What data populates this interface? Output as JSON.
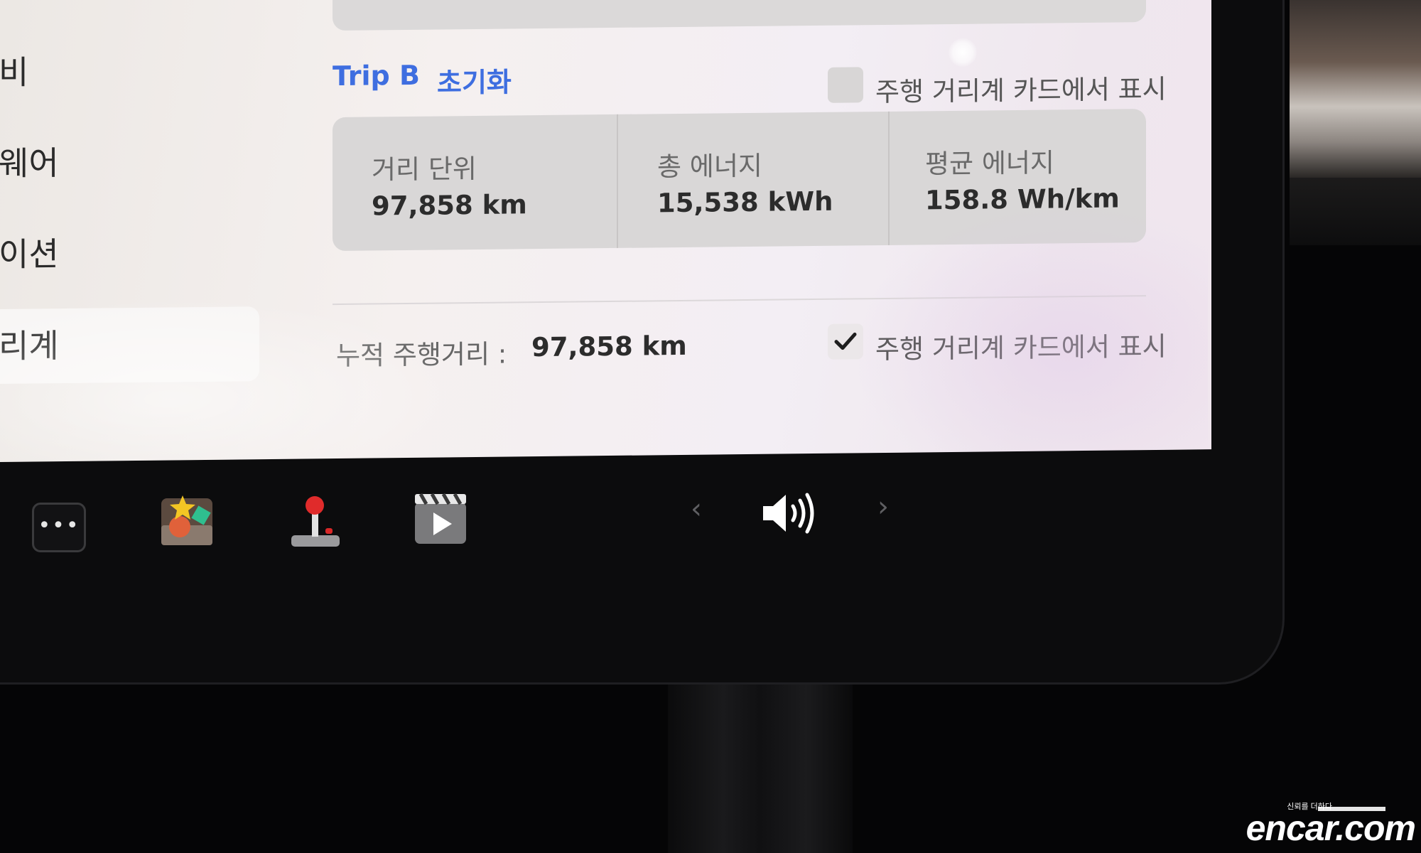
{
  "sidebar": {
    "items": [
      {
        "label": "비"
      },
      {
        "label": "웨어"
      },
      {
        "label": "이션"
      },
      {
        "label": "리계"
      }
    ]
  },
  "trip": {
    "title": "Trip B",
    "reset_label": "초기화",
    "show_on_card_label": "주행 거리계 카드에서 표시",
    "show_on_card_checked": false,
    "stats": [
      {
        "label": "거리 단위",
        "value": "97,858 km"
      },
      {
        "label": "총 에너지",
        "value": "15,538 kWh"
      },
      {
        "label": "평균 에너지",
        "value": "158.8 Wh/km"
      }
    ]
  },
  "odometer": {
    "label": "누적 주행거리 :",
    "value": "97,858 km",
    "show_on_card_label": "주행 거리계 카드에서 표시",
    "show_on_card_checked": true
  },
  "dock": {
    "more_label": "•••",
    "icons": [
      "more-icon",
      "toybox-icon",
      "arcade-joystick-icon",
      "theater-icon",
      "volume-icon"
    ],
    "prev_label": "‹",
    "next_label": "›"
  },
  "watermark": {
    "brand": "encar.com",
    "tagline": "신뢰를 더하다"
  },
  "colors": {
    "accent": "#3e6ee0",
    "screen_bg": "#f3eff0",
    "card_bg": "#d9d7d7"
  }
}
